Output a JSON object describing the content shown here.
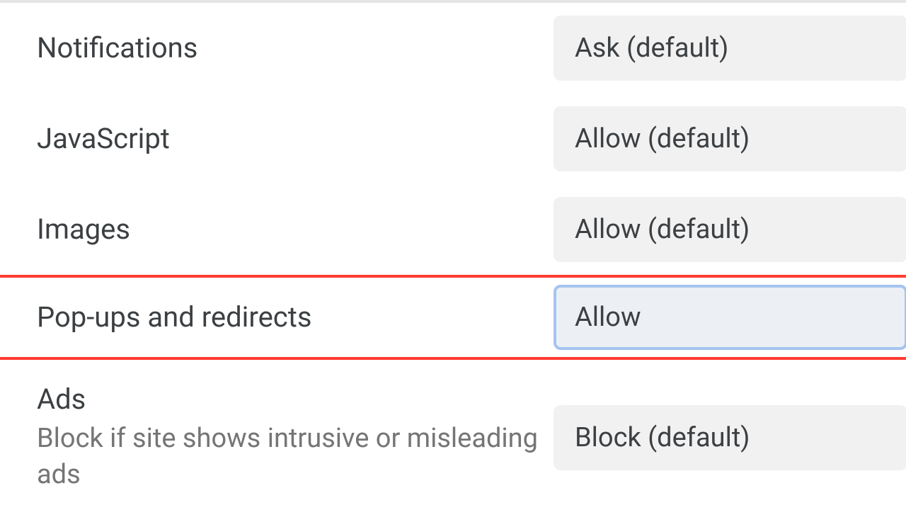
{
  "settings": [
    {
      "label": "Notifications",
      "subtitle": "",
      "value": "Ask (default)",
      "highlighted": false
    },
    {
      "label": "JavaScript",
      "subtitle": "",
      "value": "Allow (default)",
      "highlighted": false
    },
    {
      "label": "Images",
      "subtitle": "",
      "value": "Allow (default)",
      "highlighted": false
    },
    {
      "label": "Pop-ups and redirects",
      "subtitle": "",
      "value": "Allow",
      "highlighted": true
    },
    {
      "label": "Ads",
      "subtitle": "Block if site shows intrusive or misleading ads",
      "value": "Block (default)",
      "highlighted": false
    }
  ]
}
